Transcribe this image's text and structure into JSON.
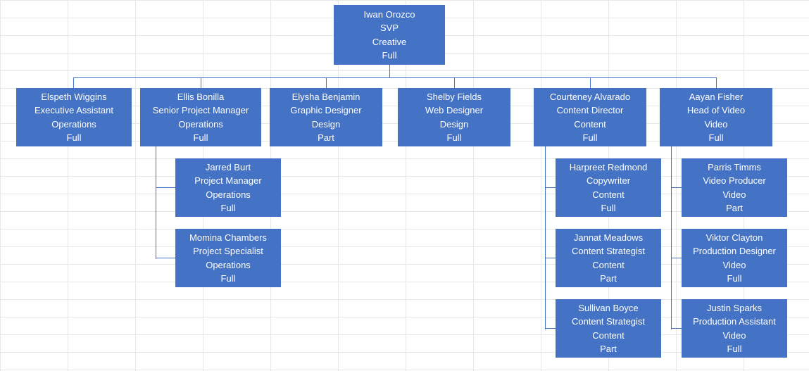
{
  "chart_data": {
    "type": "org-chart",
    "title": "",
    "root": {
      "name": "Iwan Orozco",
      "title": "SVP",
      "department": "Creative",
      "employment": "Full",
      "children": [
        {
          "name": "Elspeth Wiggins",
          "title": "Executive Assistant",
          "department": "Operations",
          "employment": "Full",
          "children": []
        },
        {
          "name": "Ellis Bonilla",
          "title": "Senior Project Manager",
          "department": "Operations",
          "employment": "Full",
          "children": [
            {
              "name": "Jarred Burt",
              "title": "Project Manager",
              "department": "Operations",
              "employment": "Full",
              "children": []
            },
            {
              "name": "Momina Chambers",
              "title": "Project Specialist",
              "department": "Operations",
              "employment": "Full",
              "children": []
            }
          ]
        },
        {
          "name": "Elysha Benjamin",
          "title": "Graphic Designer",
          "department": "Design",
          "employment": "Part",
          "children": []
        },
        {
          "name": "Shelby Fields",
          "title": "Web Designer",
          "department": "Design",
          "employment": "Full",
          "children": []
        },
        {
          "name": "Courteney Alvarado",
          "title": "Content Director",
          "department": "Content",
          "employment": "Full",
          "children": [
            {
              "name": "Harpreet Redmond",
              "title": "Copywriter",
              "department": "Content",
              "employment": "Full",
              "children": []
            },
            {
              "name": "Jannat Meadows",
              "title": "Content Strategist",
              "department": "Content",
              "employment": "Part",
              "children": []
            },
            {
              "name": "Sullivan Boyce",
              "title": "Content Strategist",
              "department": "Content",
              "employment": "Part",
              "children": []
            }
          ]
        },
        {
          "name": "Aayan Fisher",
          "title": "Head of Video",
          "department": "Video",
          "employment": "Full",
          "children": [
            {
              "name": "Parris Timms",
              "title": "Video Producer",
              "department": "Video",
              "employment": "Part",
              "children": []
            },
            {
              "name": "Viktor Clayton",
              "title": "Production Designer",
              "department": "Video",
              "employment": "Full",
              "children": []
            },
            {
              "name": "Justin Sparks",
              "title": "Production Assistant",
              "department": "Video",
              "employment": "Full",
              "children": []
            }
          ]
        }
      ]
    }
  },
  "nodes": {
    "root": {
      "name": "Iwan Orozco",
      "title": "SVP",
      "dept": "Creative",
      "emp": "Full"
    },
    "a": {
      "name": "Elspeth Wiggins",
      "title": "Executive Assistant",
      "dept": "Operations",
      "emp": "Full"
    },
    "b": {
      "name": "Ellis Bonilla",
      "title": "Senior Project Manager",
      "dept": "Operations",
      "emp": "Full"
    },
    "c": {
      "name": "Elysha Benjamin",
      "title": "Graphic Designer",
      "dept": "Design",
      "emp": "Part"
    },
    "d": {
      "name": "Shelby Fields",
      "title": "Web Designer",
      "dept": "Design",
      "emp": "Full"
    },
    "e": {
      "name": "Courteney Alvarado",
      "title": "Content Director",
      "dept": "Content",
      "emp": "Full"
    },
    "f": {
      "name": "Aayan Fisher",
      "title": "Head of Video",
      "dept": "Video",
      "emp": "Full"
    },
    "b1": {
      "name": "Jarred Burt",
      "title": "Project Manager",
      "dept": "Operations",
      "emp": "Full"
    },
    "b2": {
      "name": "Momina Chambers",
      "title": "Project Specialist",
      "dept": "Operations",
      "emp": "Full"
    },
    "e1": {
      "name": "Harpreet Redmond",
      "title": "Copywriter",
      "dept": "Content",
      "emp": "Full"
    },
    "e2": {
      "name": "Jannat Meadows",
      "title": "Content Strategist",
      "dept": "Content",
      "emp": "Part"
    },
    "e3": {
      "name": "Sullivan Boyce",
      "title": "Content Strategist",
      "dept": "Content",
      "emp": "Part"
    },
    "f1": {
      "name": "Parris Timms",
      "title": "Video Producer",
      "dept": "Video",
      "emp": "Part"
    },
    "f2": {
      "name": "Viktor Clayton",
      "title": "Production Designer",
      "dept": "Video",
      "emp": "Full"
    },
    "f3": {
      "name": "Justin Sparks",
      "title": "Production Assistant",
      "dept": "Video",
      "emp": "Full"
    }
  },
  "colors": {
    "node_fill": "#4472c4",
    "node_text": "#ffffff",
    "grid_line": "#e8e8e8"
  }
}
